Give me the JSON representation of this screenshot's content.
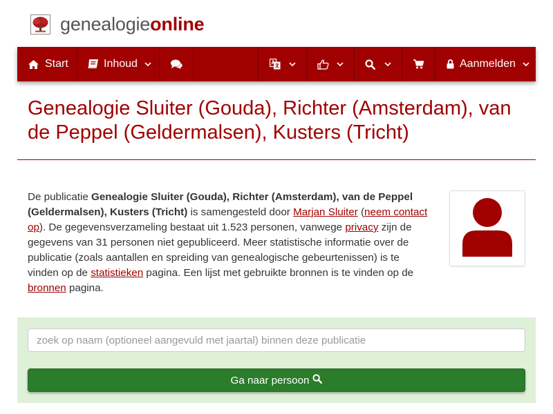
{
  "site": {
    "logo_text_light": "genealogie",
    "logo_text_bold": "online",
    "brand_color": "#a00000"
  },
  "nav": {
    "start_label": "Start",
    "start_icon": "home-icon",
    "inhoud_label": "Inhoud",
    "inhoud_icon": "book-icon",
    "chat_icon": "comments-icon",
    "language_icon": "language-icon",
    "share_icon": "thumbs-up-icon",
    "search_icon": "search-icon",
    "cart_icon": "shopping-cart-icon",
    "login_label": "Aanmelden",
    "login_icon": "lock-icon"
  },
  "page": {
    "title": "Genealogie Sluiter (Gouda), Richter (Amsterdam), van de Peppel (Geldermalsen), Kusters (Tricht)"
  },
  "intro": {
    "text_1": "De publicatie ",
    "publication_name": "Genealogie Sluiter (Gouda), Richter (Amsterdam), van de Peppel (Geldermalsen), Kusters (Tricht)",
    "text_2": " is samengesteld door ",
    "author_link": "Marjan Sluiter",
    "text_3": " (",
    "contact_link": "neem contact op",
    "text_4": "). De gegevensverzameling bestaat uit 1.523 personen, vanwege ",
    "privacy_link": "privacy",
    "text_5": " zijn de gegevens van 31 personen niet gepubliceerd. Meer statistische informatie over de publicatie (zoals aantallen en spreiding van genealogische gebeurtenissen) is te vinden op de ",
    "statistics_link": "statistieken",
    "text_6": " pagina. Een lijst met gebruikte bronnen is te vinden op de ",
    "sources_link": "bronnen",
    "text_7": " pagina.",
    "avatar_icon": "user-icon"
  },
  "search": {
    "placeholder": "zoek op naam (optioneel aangevuld met jaartal) binnen deze publicatie",
    "value": "",
    "button_label": "Ga naar persoon",
    "panel_color": "#dff0d8",
    "button_color": "#2b7d2b"
  }
}
